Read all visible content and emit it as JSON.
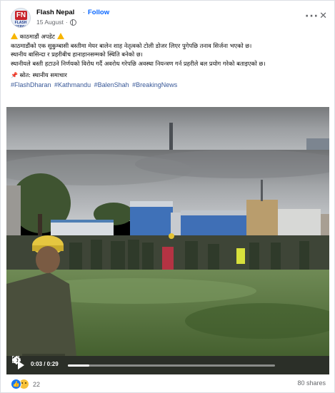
{
  "post": {
    "page_name": "Flash Nepal",
    "separator": "·",
    "follow_label": "Follow",
    "date": "15 August",
    "avatar_logo_mark": "FN",
    "avatar_logo_text": "FLASH NEPAL",
    "more_icon": "more-horizontal-icon",
    "close_icon": "close-icon",
    "more_glyph": "···",
    "close_glyph": "✕"
  },
  "body": {
    "headline": "काठमाडौं अपडेट",
    "line1": "काठमाडौंको एक सुकुम्बासी बस्तीमा मेयर बालेन शाह नेतृत्वको टोली डोजर लिएर पुगेपछि तनाव सिर्जना भएको छ।",
    "line2": "स्थानीय बासिन्दा र प्रहरीबीच हानाहानसम्मको स्थिति बनेको छ।",
    "line3": "स्थानीयले बस्ती हटाउने निर्णयको विरोध गर्दै अवरोध गरेपछि अवस्था नियन्त्रण गर्न प्रहरीले बल प्रयोग गरेको बताइएको छ।",
    "source": "स्रोत: स्थानीय समाचार",
    "pin_glyph": "📌",
    "hashtags": [
      "#FlashDharan",
      "#Kathmandu",
      "#BalenShah",
      "#BreakingNews"
    ]
  },
  "video": {
    "time": "0:03 / 0:29",
    "progress_fraction": 0.103
  },
  "footer": {
    "reaction_count": "22",
    "like_glyph": "👍",
    "shares": "80 shares"
  },
  "colors": {
    "accent": "#0866ff",
    "hashtag": "#385898",
    "warning": "#f7b500"
  }
}
